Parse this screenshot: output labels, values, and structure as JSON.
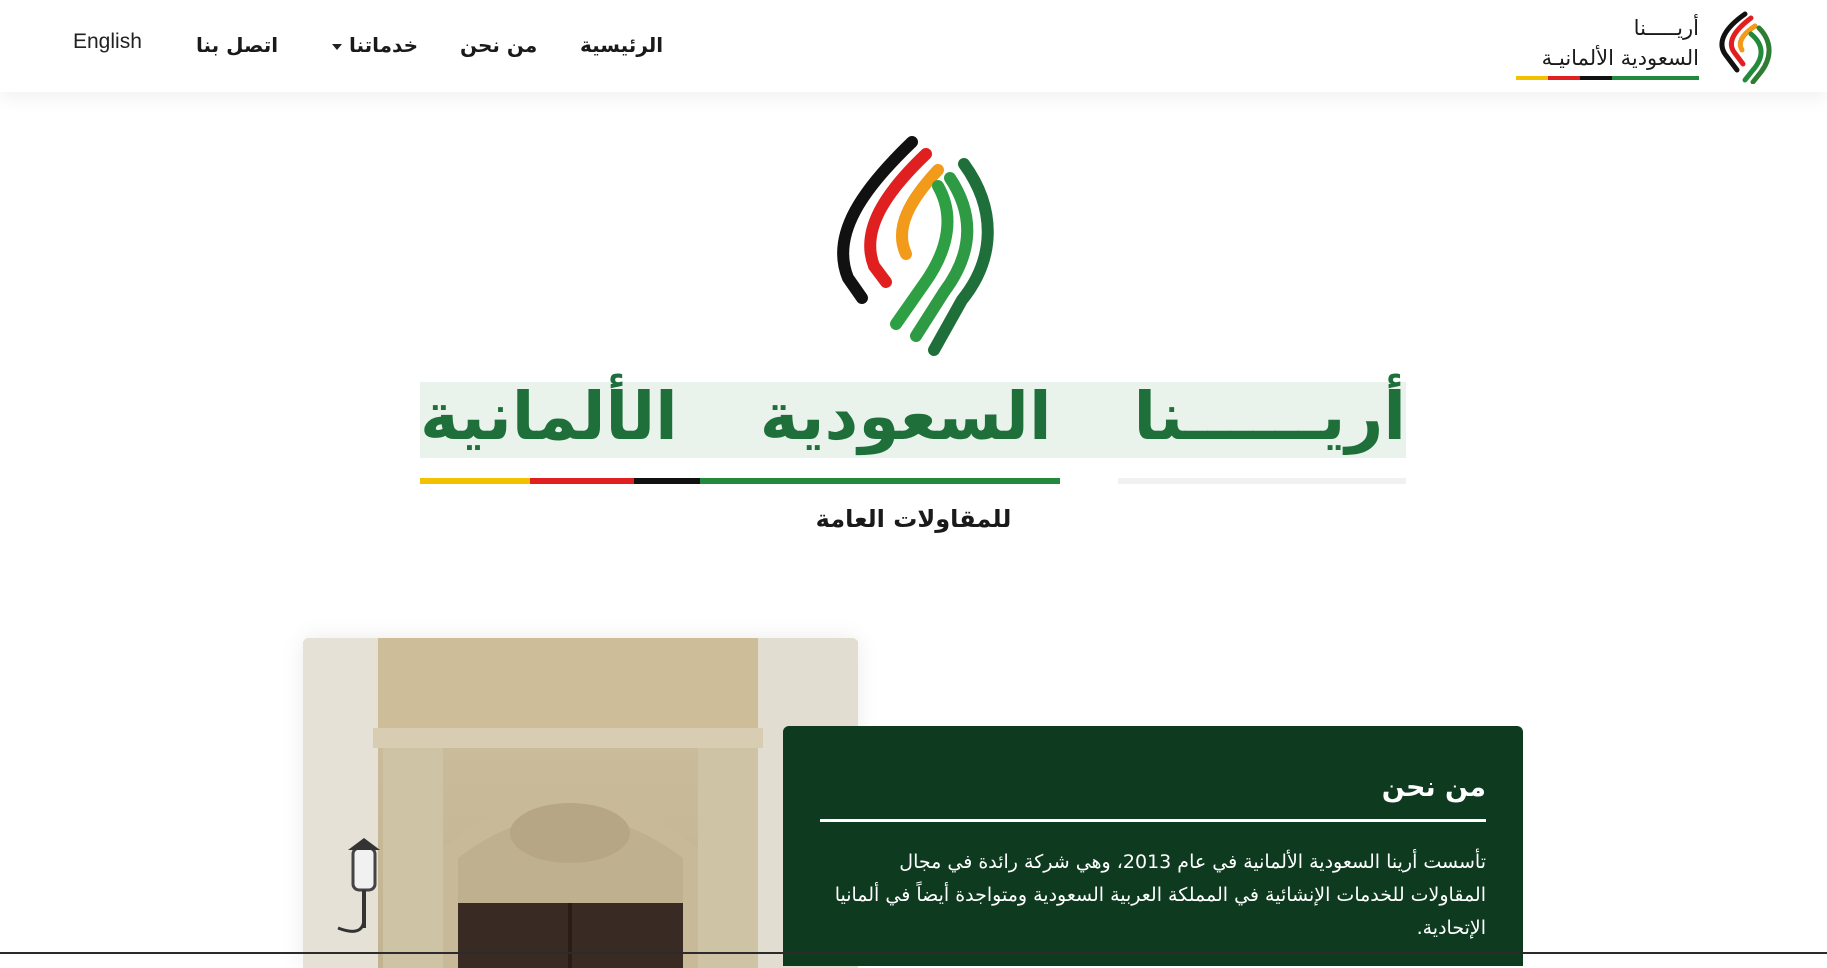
{
  "header": {
    "language_link": "English",
    "nav": {
      "home": "الرئيسية",
      "about": "من نحن",
      "services": "خدماتنا",
      "contact": "اتصل بنا"
    },
    "brand": {
      "line1": "أريـــــنا",
      "line2": "السعودية الألمانيـة",
      "colors": [
        "#f2c100",
        "#e02020",
        "#111111",
        "#238a3c"
      ]
    }
  },
  "hero": {
    "title": "أريــــــنا السعودية الألمانية",
    "subtitle": "للمقاولات العامة",
    "accent_colors": {
      "yellow": "#f2c100",
      "red": "#e02020",
      "black": "#111111",
      "green": "#238a3c",
      "dark_green": "#1e6f3a"
    }
  },
  "about": {
    "title": "من نحن",
    "text": "تأسست أرينا السعودية الألمانية في عام 2013، وهي شركة رائدة في مجال المقاولات للخدمات الإنشائية في المملكة العربية السعودية ومتواجدة أيضاً في ألمانيا الإتحادية.",
    "background": "#0e3a20"
  },
  "icons": {
    "brand_logo": "arena-logo-icon",
    "dropdown": "caret-down-icon",
    "photo": "building-entrance-photo"
  }
}
